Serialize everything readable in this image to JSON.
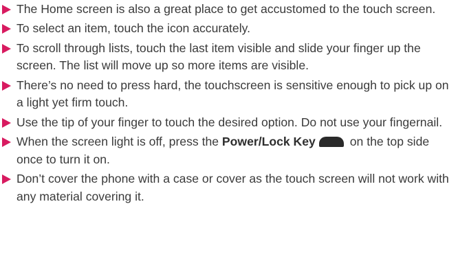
{
  "colors": {
    "bullet": "#d81b60",
    "text": "#3a3a3a",
    "key_icon": "#2a2a2a"
  },
  "tips": [
    {
      "text": "The Home screen is also a great place to get accustomed to the touch screen."
    },
    {
      "text": "To select an item, touch the icon accurately."
    },
    {
      "text": "To scroll through lists, touch the last item visible and slide your finger up the screen. The list will move up so more items are visible."
    },
    {
      "text": "There’s no need to press hard, the touchscreen is sensitive enough to pick up on a light yet firm touch."
    },
    {
      "text": "Use the tip of your finger to touch the desired option. Do not use your fingernail."
    },
    {
      "text_before": "When the screen light is off, press the ",
      "key_name": "Power/Lock Key",
      "key_icon": "power-lock-key-icon",
      "text_after": " on the top side once to turn it on."
    },
    {
      "text": "Don’t cover the phone with a case or cover as the touch screen will not work with any material covering it."
    }
  ]
}
